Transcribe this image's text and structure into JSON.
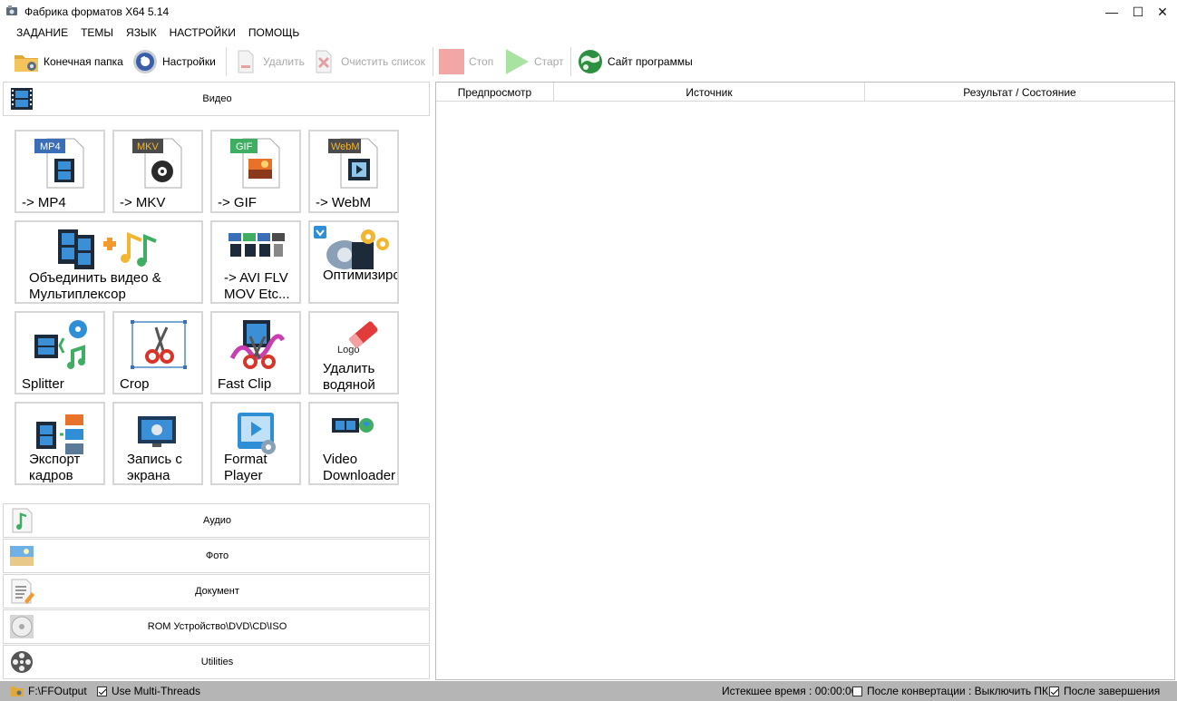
{
  "window": {
    "title": "Фабрика форматов X64 5.14",
    "minimize": "—",
    "maximize": "☐",
    "close": "✕"
  },
  "menu": [
    "ЗАДАНИЕ",
    "ТЕМЫ",
    "ЯЗЫК",
    "НАСТРОЙКИ",
    "ПОМОЩЬ"
  ],
  "toolbar": {
    "output_folder": "Конечная папка",
    "settings": "Настройки",
    "remove": "Удалить",
    "clear_list": "Очистить список",
    "stop": "Стоп",
    "start": "Старт",
    "website": "Сайт программы"
  },
  "categories": {
    "video": "Видео",
    "audio": "Аудио",
    "photo": "Фото",
    "document": "Документ",
    "rom": "ROM Устройство\\DVD\\CD\\ISO",
    "utilities": "Utilities"
  },
  "tiles": {
    "mp4": {
      "label": "-> MP4",
      "badge": "MP4"
    },
    "mkv": {
      "label": "-> MKV",
      "badge": "MKV"
    },
    "gif": {
      "label": "-> GIF",
      "badge": "GIF"
    },
    "webm": {
      "label": "-> WebM",
      "badge": "WebM"
    },
    "join": {
      "line1": "Объединить видео &",
      "line2": "Мультиплексор"
    },
    "avi": {
      "line1": "-> AVI FLV",
      "line2": "MOV Etc..."
    },
    "optimize": {
      "label": "Оптимизиро"
    },
    "splitter": {
      "label": "Splitter"
    },
    "crop": {
      "label": "Crop"
    },
    "fastclip": {
      "label": "Fast Clip"
    },
    "watermark": {
      "line1": "Удалить",
      "line2": "водяной",
      "logo": "Logo"
    },
    "export": {
      "line1": "Экспорт",
      "line2": "кадров"
    },
    "record": {
      "line1": "Запись с",
      "line2": "экрана"
    },
    "player": {
      "line1": "Format",
      "line2": "Player"
    },
    "downloader": {
      "line1": "Video",
      "line2": "Downloader"
    }
  },
  "list_columns": {
    "preview": "Предпросмотр",
    "source": "Источник",
    "result": "Результат / Состояние"
  },
  "status": {
    "output_path": "F:\\FFOutput",
    "multithreads": "Use Multi-Threads",
    "multithreads_checked": true,
    "elapsed": "Истекшее время : 00:00:00",
    "shutdown": "После конвертации : Выключить ПК",
    "shutdown_checked": false,
    "after_finish": "После завершения",
    "after_finish_checked": true
  }
}
